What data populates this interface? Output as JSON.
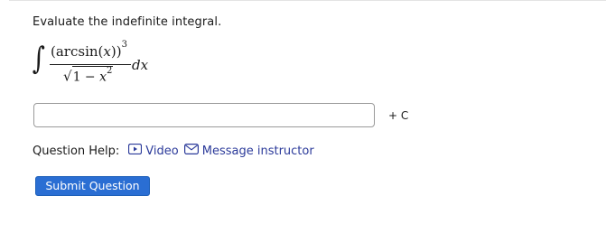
{
  "question": {
    "prompt": "Evaluate the indefinite integral.",
    "integral": {
      "sign": "∫",
      "numerator_base": "(arcsin(",
      "numerator_var": "x",
      "numerator_close": "))",
      "numerator_power": "3",
      "radical": "√",
      "denominator_text": "1 − ",
      "denominator_var": "x",
      "denominator_power": "2",
      "differential": "dx"
    }
  },
  "answer": {
    "value": "",
    "placeholder": "",
    "suffix": "+ C"
  },
  "help": {
    "label": "Question Help:",
    "links": [
      {
        "label": "Video",
        "icon": "video-icon"
      },
      {
        "label": "Message instructor",
        "icon": "mail-icon"
      }
    ],
    "link_color": "#2b3a9a"
  },
  "submit": {
    "label": "Submit Question",
    "color": "#2a6ed3"
  }
}
